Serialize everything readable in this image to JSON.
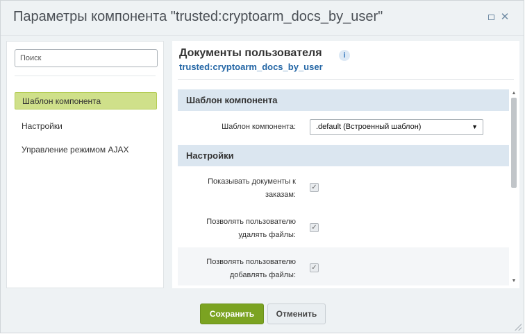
{
  "window": {
    "title": "Параметры компонента \"trusted:cryptoarm_docs_by_user\"",
    "maximize_icon": "maximize-icon",
    "close_icon": "close-icon",
    "close_glyph": "✕"
  },
  "sidebar": {
    "search": {
      "placeholder": "Поиск",
      "value": ""
    },
    "items": [
      {
        "label": "Шаблон компонента",
        "active": true
      },
      {
        "label": "Настройки",
        "active": false
      },
      {
        "label": "Управление режимом AJAX",
        "active": false
      }
    ]
  },
  "main": {
    "title": "Документы пользователя",
    "info_glyph": "i",
    "component_code": "trusted:cryptoarm_docs_by_user",
    "sections": [
      {
        "title": "Шаблон компонента",
        "fields": [
          {
            "label": "Шаблон компонента:",
            "type": "select",
            "value": ".default (Встроенный шаблон)",
            "arrow": "▼"
          }
        ]
      },
      {
        "title": "Настройки",
        "fields": [
          {
            "label_line1": "Показывать документы к",
            "label_line2": "заказам:",
            "type": "checkbox",
            "checked": true,
            "glyph": "✓"
          },
          {
            "label_line1": "Позволять пользователю",
            "label_line2": "удалять файлы:",
            "type": "checkbox",
            "checked": true,
            "glyph": "✓"
          },
          {
            "label_line1": "Позволять пользователю",
            "label_line2": "добавлять файлы:",
            "type": "checkbox",
            "checked": true,
            "glyph": "✓"
          }
        ]
      }
    ],
    "scrollbar": {
      "up": "▲",
      "down": "▼"
    }
  },
  "footer": {
    "save_label": "Сохранить",
    "cancel_label": "Отменить"
  }
}
